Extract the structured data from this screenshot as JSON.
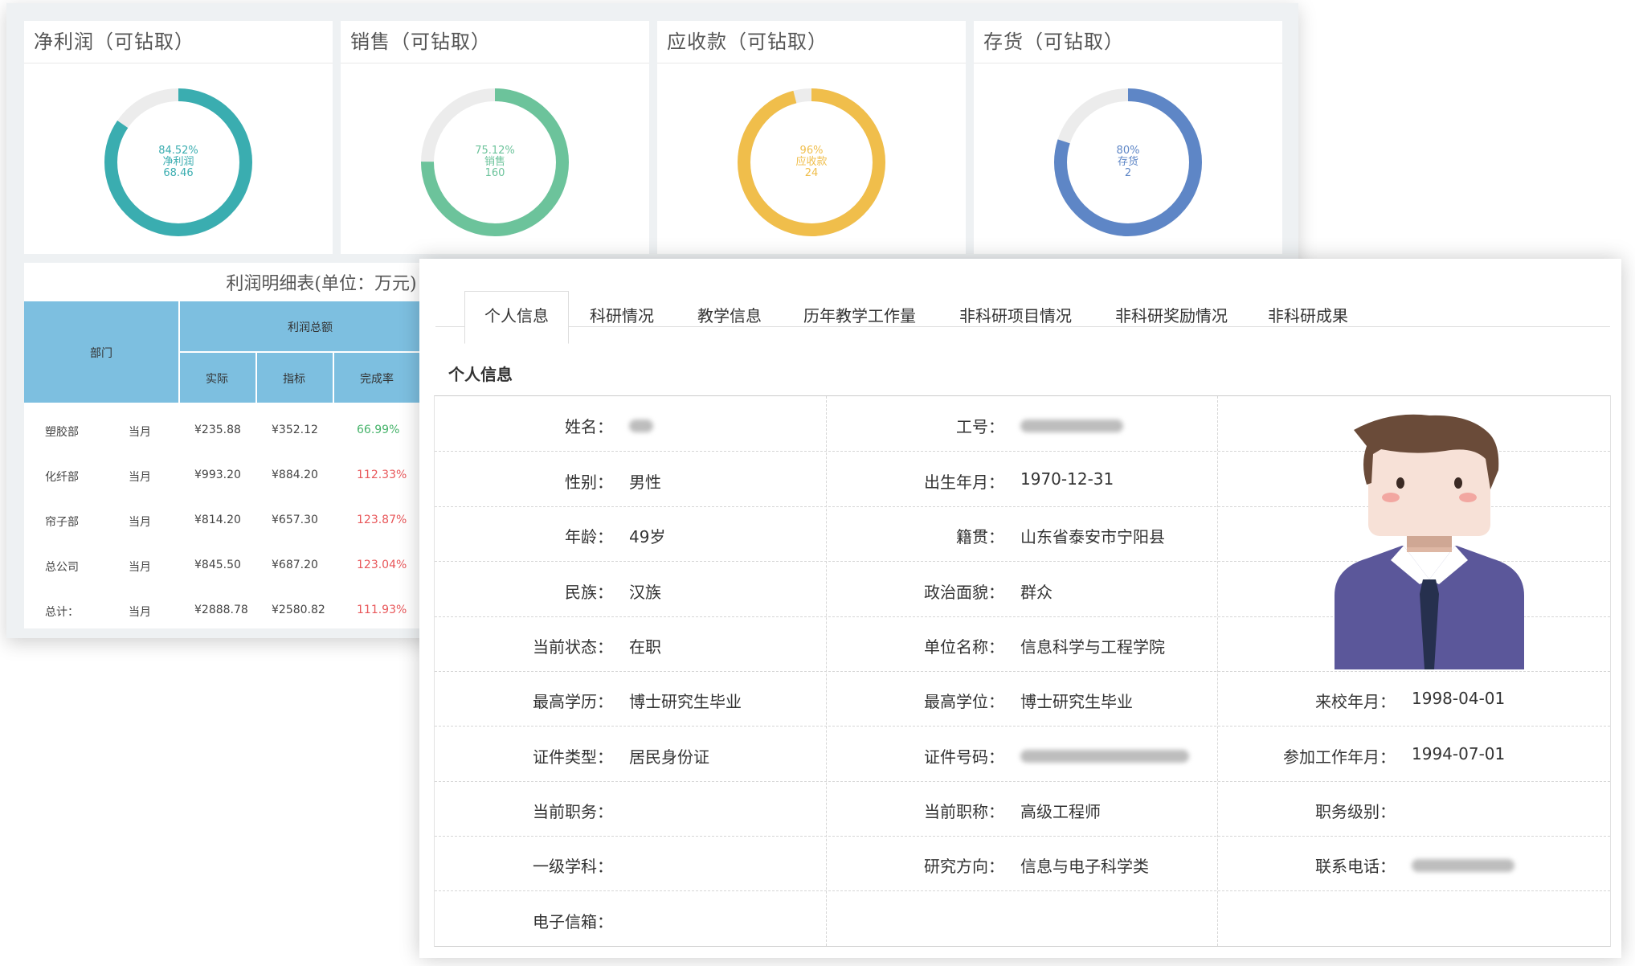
{
  "dashboard": {
    "cards": [
      {
        "title": "净利润（可钻取）",
        "percent": "84.52%",
        "name": "净利润",
        "value": "68.46",
        "ratio": 0.8452,
        "color": "#3aadb0"
      },
      {
        "title": "销售（可钻取）",
        "percent": "75.12%",
        "name": "销售",
        "value": "160",
        "ratio": 0.7512,
        "color": "#6cc39b"
      },
      {
        "title": "应收款（可钻取）",
        "percent": "96%",
        "name": "应收款",
        "value": "24",
        "ratio": 0.96,
        "color": "#f0be4b"
      },
      {
        "title": "存货（可钻取）",
        "percent": "80%",
        "name": "存货",
        "value": "2",
        "ratio": 0.8,
        "color": "#5e86c6"
      }
    ],
    "detail": {
      "title": "利润明细表(单位：万元)",
      "header_dept": "部门",
      "header_profit": "利润总额",
      "header_actual": "实际",
      "header_target": "指标",
      "header_rate": "完成率",
      "rows": [
        {
          "dept": "塑胶部",
          "period": "当月",
          "actual": "¥235.88",
          "target": "¥352.12",
          "rate": "66.99%",
          "good": true
        },
        {
          "dept": "化纤部",
          "period": "当月",
          "actual": "¥993.20",
          "target": "¥884.20",
          "rate": "112.33%",
          "good": false
        },
        {
          "dept": "帘子部",
          "period": "当月",
          "actual": "¥814.20",
          "target": "¥657.30",
          "rate": "123.87%",
          "good": false
        },
        {
          "dept": "总公司",
          "period": "当月",
          "actual": "¥845.50",
          "target": "¥687.20",
          "rate": "123.04%",
          "good": false
        },
        {
          "dept": "总计：",
          "period": "当月",
          "actual": "¥2888.78",
          "target": "¥2580.82",
          "rate": "111.93%",
          "good": false
        }
      ]
    }
  },
  "info": {
    "tabs": [
      "个人信息",
      "科研情况",
      "教学信息",
      "历年教学工作量",
      "非科研项目情况",
      "非科研奖励情况",
      "非科研成果"
    ],
    "section_title": "个人信息",
    "fields": {
      "name_label": "姓名：",
      "staff_no_label": "工号：",
      "gender_label": "性别：",
      "gender": "男性",
      "birth_label": "出生年月：",
      "birth": "1970-12-31",
      "age_label": "年龄：",
      "age": "49岁",
      "native_label": "籍贯：",
      "native": "山东省泰安市宁阳县",
      "ethnic_label": "民族：",
      "ethnic": "汉族",
      "political_label": "政治面貌：",
      "political": "群众",
      "status_label": "当前状态：",
      "status": "在职",
      "unit_label": "单位名称：",
      "unit": "信息科学与工程学院",
      "edu_label": "最高学历：",
      "edu": "博士研究生毕业",
      "degree_label": "最高学位：",
      "degree": "博士研究生毕业",
      "arrive_label": "来校年月：",
      "arrive": "1998-04-01",
      "idtype_label": "证件类型：",
      "idtype": "居民身份证",
      "idno_label": "证件号码：",
      "work_label": "参加工作年月：",
      "work": "1994-07-01",
      "post_label": "当前职务：",
      "title_label": "当前职称：",
      "title": "高级工程师",
      "level_label": "职务级别：",
      "subject_label": "一级学科：",
      "direction_label": "研究方向：",
      "direction": "信息与电子科学类",
      "phone_label": "联系电话：",
      "email_label": "电子信箱："
    }
  }
}
